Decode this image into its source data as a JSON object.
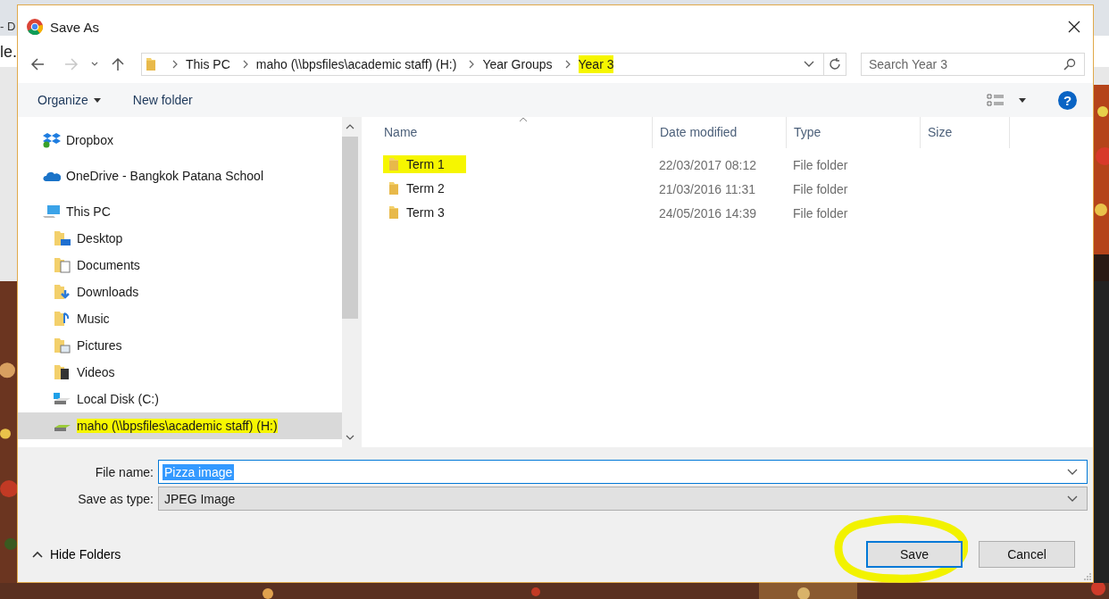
{
  "background": {
    "tab_text": "- D",
    "address_text": "le."
  },
  "window": {
    "title": "Save As"
  },
  "address_bar": {
    "crumbs": [
      {
        "label": "This PC",
        "highlighted": false
      },
      {
        "label": "maho (\\\\bpsfiles\\academic staff) (H:)",
        "highlighted": false
      },
      {
        "label": "Year Groups",
        "highlighted": false
      },
      {
        "label": "Year 3",
        "highlighted": true
      }
    ]
  },
  "search": {
    "placeholder": "Search Year 3"
  },
  "toolbar": {
    "organize": "Organize",
    "new_folder": "New folder",
    "help": "?"
  },
  "nav_pane": {
    "items": [
      {
        "label": "Dropbox",
        "kind": "dropbox",
        "selected": false,
        "highlighted": false
      },
      {
        "label": "OneDrive - Bangkok Patana School",
        "kind": "onedrive",
        "selected": false,
        "highlighted": false
      },
      {
        "label": "This PC",
        "kind": "pc",
        "selected": false,
        "highlighted": false,
        "children": [
          {
            "label": "Desktop",
            "kind": "desktop",
            "selected": false,
            "highlighted": false
          },
          {
            "label": "Documents",
            "kind": "documents",
            "selected": false,
            "highlighted": false
          },
          {
            "label": "Downloads",
            "kind": "downloads",
            "selected": false,
            "highlighted": false
          },
          {
            "label": "Music",
            "kind": "music",
            "selected": false,
            "highlighted": false
          },
          {
            "label": "Pictures",
            "kind": "pictures",
            "selected": false,
            "highlighted": false
          },
          {
            "label": "Videos",
            "kind": "videos",
            "selected": false,
            "highlighted": false
          },
          {
            "label": "Local Disk (C:)",
            "kind": "disk",
            "selected": false,
            "highlighted": false
          },
          {
            "label": "maho (\\\\bpsfiles\\academic staff) (H:)",
            "kind": "network-drive",
            "selected": true,
            "highlighted": true
          }
        ]
      }
    ]
  },
  "file_list": {
    "columns": [
      {
        "label": "Name",
        "sorted": true
      },
      {
        "label": "Date modified",
        "sorted": false
      },
      {
        "label": "Type",
        "sorted": false
      },
      {
        "label": "Size",
        "sorted": false
      }
    ],
    "rows": [
      {
        "name": "Term 1",
        "date": "22/03/2017 08:12",
        "type": "File folder",
        "highlighted": true
      },
      {
        "name": "Term 2",
        "date": "21/03/2016 11:31",
        "type": "File folder",
        "highlighted": false
      },
      {
        "name": "Term 3",
        "date": "24/05/2016 14:39",
        "type": "File folder",
        "highlighted": false
      }
    ]
  },
  "form": {
    "file_name_label": "File name:",
    "file_name": "Pizza image",
    "file_name_text_selected": true,
    "type_label": "Save as type:",
    "type_value": "JPEG Image"
  },
  "footer": {
    "hide_folders": "Hide Folders",
    "buttons": [
      {
        "label": "Save",
        "kind": "primary",
        "highlighted": true
      },
      {
        "label": "Cancel",
        "kind": "secondary",
        "highlighted": false
      }
    ]
  }
}
